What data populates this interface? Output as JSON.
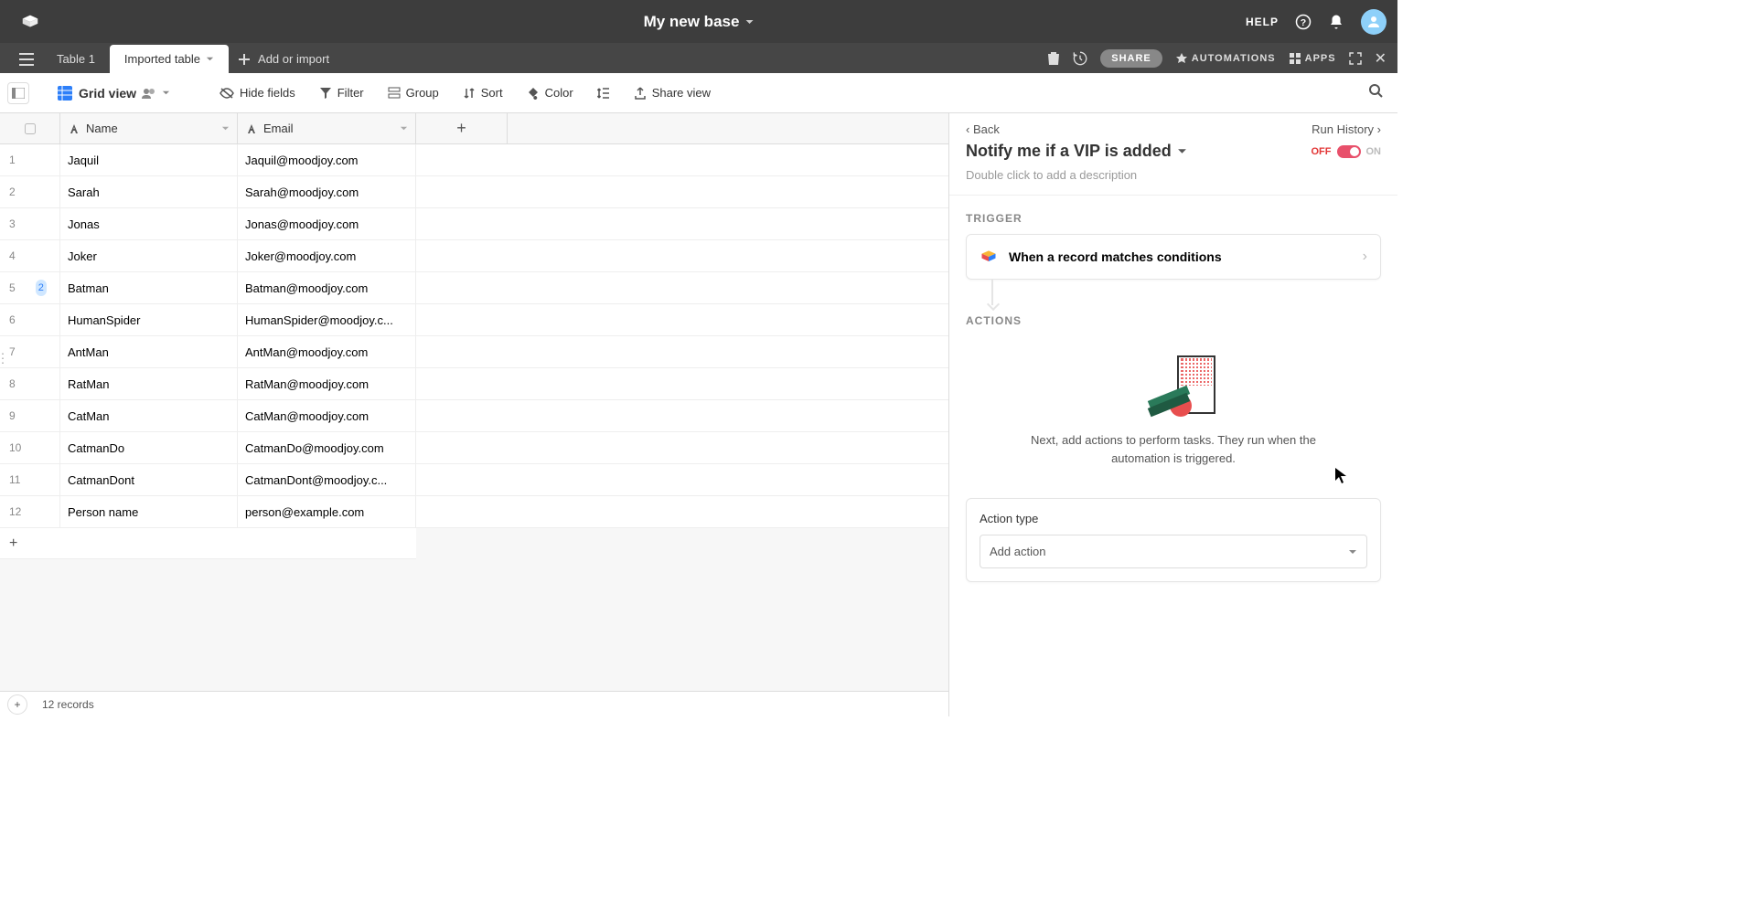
{
  "header": {
    "base_title": "My new base",
    "help": "HELP"
  },
  "tabs": {
    "table1": "Table 1",
    "imported": "Imported table",
    "add": "Add or import"
  },
  "tabsbar_right": {
    "share": "SHARE",
    "automations": "AUTOMATIONS",
    "apps": "APPS"
  },
  "toolbar": {
    "gridview": "Grid view",
    "hide_fields": "Hide fields",
    "filter": "Filter",
    "group": "Group",
    "sort": "Sort",
    "color": "Color",
    "share_view": "Share view"
  },
  "columns": {
    "name": "Name",
    "email": "Email"
  },
  "rows": [
    {
      "idx": "1",
      "name": "Jaquil",
      "email": "Jaquil@moodjoy.com"
    },
    {
      "idx": "2",
      "name": "Sarah",
      "email": "Sarah@moodjoy.com"
    },
    {
      "idx": "3",
      "name": "Jonas",
      "email": "Jonas@moodjoy.com"
    },
    {
      "idx": "4",
      "name": "Joker",
      "email": "Joker@moodjoy.com"
    },
    {
      "idx": "5",
      "name": "Batman",
      "email": "Batman@moodjoy.com",
      "badge": "2"
    },
    {
      "idx": "6",
      "name": "HumanSpider",
      "email": "HumanSpider@moodjoy.c..."
    },
    {
      "idx": "7",
      "name": "AntMan",
      "email": "AntMan@moodjoy.com"
    },
    {
      "idx": "8",
      "name": "RatMan",
      "email": "RatMan@moodjoy.com"
    },
    {
      "idx": "9",
      "name": "CatMan",
      "email": "CatMan@moodjoy.com"
    },
    {
      "idx": "10",
      "name": "CatmanDo",
      "email": "CatmanDo@moodjoy.com"
    },
    {
      "idx": "11",
      "name": "CatmanDont",
      "email": "CatmanDont@moodjoy.c..."
    },
    {
      "idx": "12",
      "name": "Person name",
      "email": "person@example.com"
    }
  ],
  "footer": {
    "count": "12 records"
  },
  "panel": {
    "back": "Back",
    "history": "Run History",
    "title": "Notify me if a VIP is added",
    "off": "OFF",
    "on": "ON",
    "desc": "Double click to add a description",
    "trigger_label": "TRIGGER",
    "trigger_text": "When a record matches conditions",
    "actions_label": "ACTIONS",
    "actions_text": "Next, add actions to perform tasks. They run when the automation is triggered.",
    "action_type": "Action type",
    "add_action": "Add action"
  }
}
